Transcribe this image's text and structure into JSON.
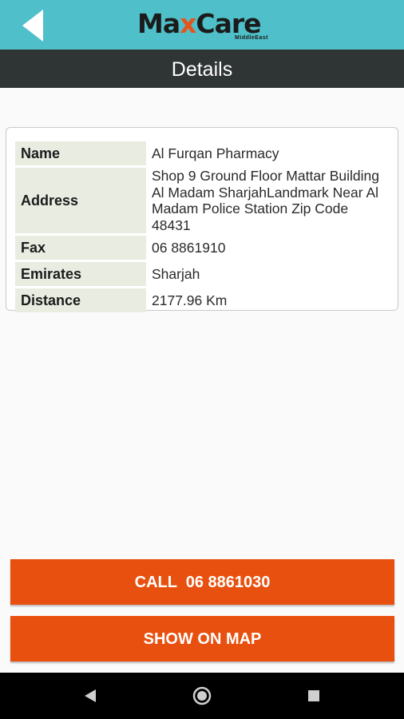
{
  "app": {
    "logo_text_pre": "Ma",
    "logo_text_x": "x",
    "logo_text_post": "Care",
    "logo_sub": "MiddleEast",
    "title": "Details"
  },
  "details": {
    "rows": [
      {
        "label": "Name",
        "value": "Al Furqan Pharmacy"
      },
      {
        "label": "Address",
        "value": "Shop 9 Ground Floor Mattar Building Al Madam SharjahLandmark Near Al Madam Police Station Zip Code 48431"
      },
      {
        "label": "Fax",
        "value": "06 8861910"
      },
      {
        "label": "Emirates",
        "value": "Sharjah"
      },
      {
        "label": "Distance",
        "value": "2177.96 Km"
      }
    ]
  },
  "actions": {
    "call_label": "CALL  06 8861030",
    "map_label": "SHOW ON MAP"
  },
  "colors": {
    "header": "#4fc0c9",
    "titlebar": "#2f3434",
    "accent": "#e8500f",
    "label_bg": "#e8ece1"
  },
  "icons": {
    "back": "back-arrow-icon",
    "nav_back": "nav-back-icon",
    "nav_home": "nav-home-icon",
    "nav_recents": "nav-recents-icon"
  }
}
